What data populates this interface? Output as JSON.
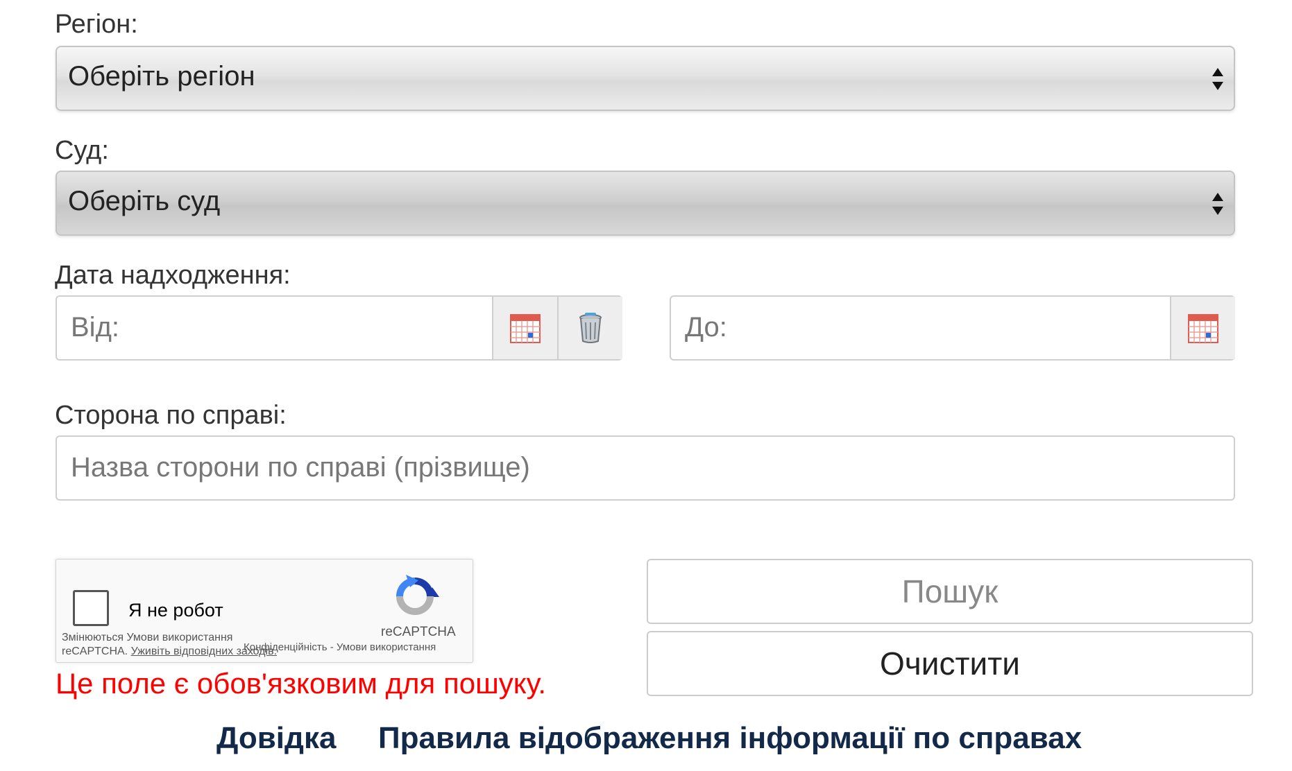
{
  "region": {
    "label": "Регіон:",
    "selected": "Оберіть регіон"
  },
  "court": {
    "label": "Суд:",
    "selected": "Оберіть суд"
  },
  "date": {
    "label": "Дата надходження:",
    "from_placeholder": "Від:",
    "to_placeholder": "До:"
  },
  "party": {
    "label": "Сторона по справі:",
    "placeholder": "Назва сторони по справі (прізвище)"
  },
  "recaptcha": {
    "label": "Я не робот",
    "notice_line1": "Змінюються Умови використання",
    "notice_line2_prefix": "reCAPTCHA.",
    "notice_link": "Уживіть відповідних заходів.",
    "brand": "reCAPTCHA",
    "privacy": "Конфіденційність",
    "separator": "-",
    "terms": "Умови використання"
  },
  "error_message": "Це поле є обов'язковим для пошуку.",
  "buttons": {
    "search": "Пошук",
    "clear": "Очистити"
  },
  "footer_links": {
    "help": "Довідка",
    "rules": "Правила відображення інформації по справах"
  },
  "icons": {
    "calendar": "calendar-icon",
    "trash": "trash-icon",
    "recaptcha_logo": "recaptcha-logo-icon",
    "select_arrows": "select-arrows-icon"
  },
  "colors": {
    "error": "#ff0000",
    "link": "#12294a",
    "calendar_red": "#e05a4e",
    "calendar_blue": "#2b6fd6"
  }
}
